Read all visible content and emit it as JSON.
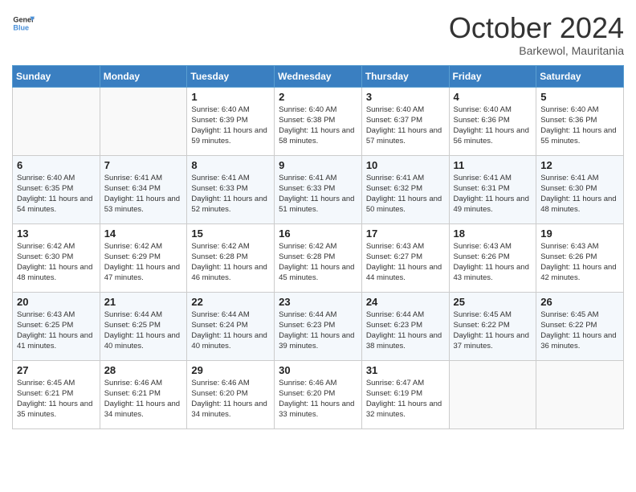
{
  "header": {
    "logo_line1": "General",
    "logo_line2": "Blue",
    "month": "October 2024",
    "location": "Barkewol, Mauritania"
  },
  "days_of_week": [
    "Sunday",
    "Monday",
    "Tuesday",
    "Wednesday",
    "Thursday",
    "Friday",
    "Saturday"
  ],
  "weeks": [
    [
      {
        "day": "",
        "info": ""
      },
      {
        "day": "",
        "info": ""
      },
      {
        "day": "1",
        "info": "Sunrise: 6:40 AM\nSunset: 6:39 PM\nDaylight: 11 hours and 59 minutes."
      },
      {
        "day": "2",
        "info": "Sunrise: 6:40 AM\nSunset: 6:38 PM\nDaylight: 11 hours and 58 minutes."
      },
      {
        "day": "3",
        "info": "Sunrise: 6:40 AM\nSunset: 6:37 PM\nDaylight: 11 hours and 57 minutes."
      },
      {
        "day": "4",
        "info": "Sunrise: 6:40 AM\nSunset: 6:36 PM\nDaylight: 11 hours and 56 minutes."
      },
      {
        "day": "5",
        "info": "Sunrise: 6:40 AM\nSunset: 6:36 PM\nDaylight: 11 hours and 55 minutes."
      }
    ],
    [
      {
        "day": "6",
        "info": "Sunrise: 6:40 AM\nSunset: 6:35 PM\nDaylight: 11 hours and 54 minutes."
      },
      {
        "day": "7",
        "info": "Sunrise: 6:41 AM\nSunset: 6:34 PM\nDaylight: 11 hours and 53 minutes."
      },
      {
        "day": "8",
        "info": "Sunrise: 6:41 AM\nSunset: 6:33 PM\nDaylight: 11 hours and 52 minutes."
      },
      {
        "day": "9",
        "info": "Sunrise: 6:41 AM\nSunset: 6:33 PM\nDaylight: 11 hours and 51 minutes."
      },
      {
        "day": "10",
        "info": "Sunrise: 6:41 AM\nSunset: 6:32 PM\nDaylight: 11 hours and 50 minutes."
      },
      {
        "day": "11",
        "info": "Sunrise: 6:41 AM\nSunset: 6:31 PM\nDaylight: 11 hours and 49 minutes."
      },
      {
        "day": "12",
        "info": "Sunrise: 6:41 AM\nSunset: 6:30 PM\nDaylight: 11 hours and 48 minutes."
      }
    ],
    [
      {
        "day": "13",
        "info": "Sunrise: 6:42 AM\nSunset: 6:30 PM\nDaylight: 11 hours and 48 minutes."
      },
      {
        "day": "14",
        "info": "Sunrise: 6:42 AM\nSunset: 6:29 PM\nDaylight: 11 hours and 47 minutes."
      },
      {
        "day": "15",
        "info": "Sunrise: 6:42 AM\nSunset: 6:28 PM\nDaylight: 11 hours and 46 minutes."
      },
      {
        "day": "16",
        "info": "Sunrise: 6:42 AM\nSunset: 6:28 PM\nDaylight: 11 hours and 45 minutes."
      },
      {
        "day": "17",
        "info": "Sunrise: 6:43 AM\nSunset: 6:27 PM\nDaylight: 11 hours and 44 minutes."
      },
      {
        "day": "18",
        "info": "Sunrise: 6:43 AM\nSunset: 6:26 PM\nDaylight: 11 hours and 43 minutes."
      },
      {
        "day": "19",
        "info": "Sunrise: 6:43 AM\nSunset: 6:26 PM\nDaylight: 11 hours and 42 minutes."
      }
    ],
    [
      {
        "day": "20",
        "info": "Sunrise: 6:43 AM\nSunset: 6:25 PM\nDaylight: 11 hours and 41 minutes."
      },
      {
        "day": "21",
        "info": "Sunrise: 6:44 AM\nSunset: 6:25 PM\nDaylight: 11 hours and 40 minutes."
      },
      {
        "day": "22",
        "info": "Sunrise: 6:44 AM\nSunset: 6:24 PM\nDaylight: 11 hours and 40 minutes."
      },
      {
        "day": "23",
        "info": "Sunrise: 6:44 AM\nSunset: 6:23 PM\nDaylight: 11 hours and 39 minutes."
      },
      {
        "day": "24",
        "info": "Sunrise: 6:44 AM\nSunset: 6:23 PM\nDaylight: 11 hours and 38 minutes."
      },
      {
        "day": "25",
        "info": "Sunrise: 6:45 AM\nSunset: 6:22 PM\nDaylight: 11 hours and 37 minutes."
      },
      {
        "day": "26",
        "info": "Sunrise: 6:45 AM\nSunset: 6:22 PM\nDaylight: 11 hours and 36 minutes."
      }
    ],
    [
      {
        "day": "27",
        "info": "Sunrise: 6:45 AM\nSunset: 6:21 PM\nDaylight: 11 hours and 35 minutes."
      },
      {
        "day": "28",
        "info": "Sunrise: 6:46 AM\nSunset: 6:21 PM\nDaylight: 11 hours and 34 minutes."
      },
      {
        "day": "29",
        "info": "Sunrise: 6:46 AM\nSunset: 6:20 PM\nDaylight: 11 hours and 34 minutes."
      },
      {
        "day": "30",
        "info": "Sunrise: 6:46 AM\nSunset: 6:20 PM\nDaylight: 11 hours and 33 minutes."
      },
      {
        "day": "31",
        "info": "Sunrise: 6:47 AM\nSunset: 6:19 PM\nDaylight: 11 hours and 32 minutes."
      },
      {
        "day": "",
        "info": ""
      },
      {
        "day": "",
        "info": ""
      }
    ]
  ]
}
